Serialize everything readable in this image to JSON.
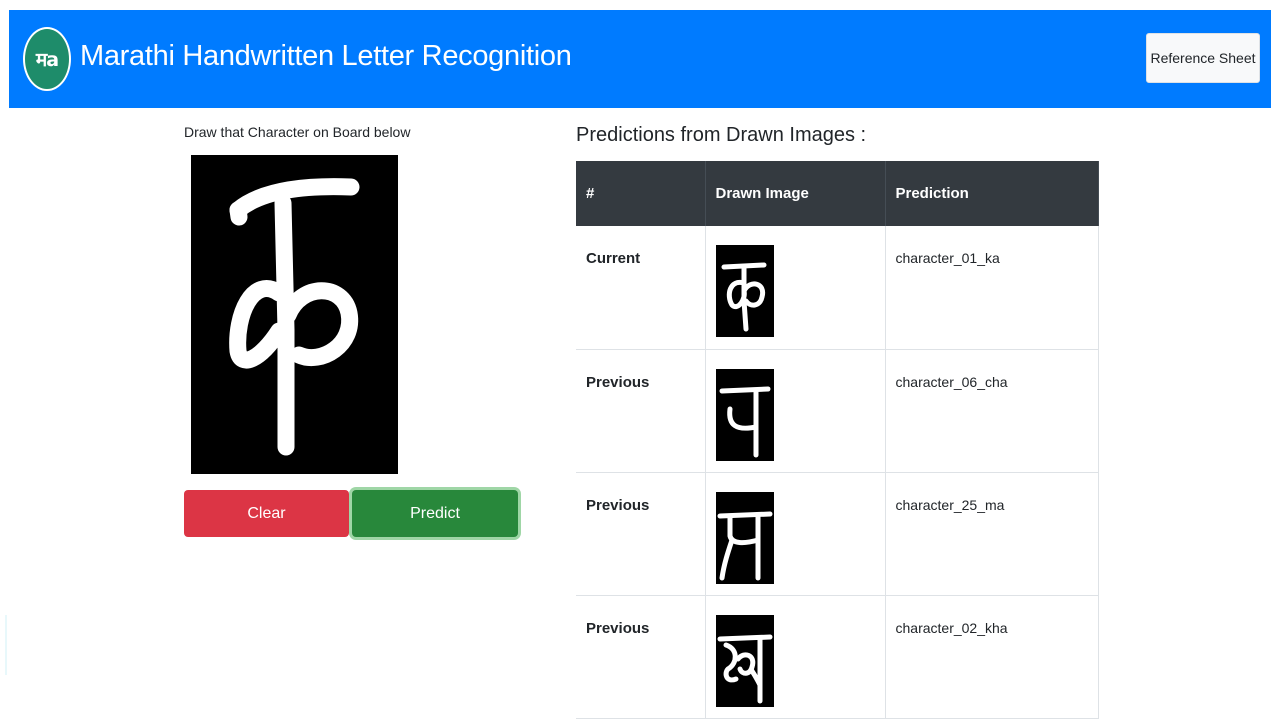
{
  "header": {
    "logo_text": "मa",
    "title": "Marathi Handwritten Letter Recognition",
    "reference_button": "Reference Sheet",
    "bg_color": "#007bff"
  },
  "board": {
    "label": "Draw that Character on Board below",
    "drawn_glyph": "क"
  },
  "buttons": {
    "clear": "Clear",
    "predict": "Predict"
  },
  "predictions": {
    "title": "Predictions from Drawn Images :",
    "columns": [
      "#",
      "Drawn Image",
      "Prediction"
    ],
    "rows": [
      {
        "label": "Current",
        "glyph": "क",
        "prediction": "character_01_ka"
      },
      {
        "label": "Previous",
        "glyph": "च",
        "prediction": "character_06_cha"
      },
      {
        "label": "Previous",
        "glyph": "म",
        "prediction": "character_25_ma"
      },
      {
        "label": "Previous",
        "glyph": "ख",
        "prediction": "character_02_kha"
      }
    ]
  },
  "colors": {
    "clear": "#dc3545",
    "predict": "#28883b",
    "table_header": "#343a40"
  }
}
